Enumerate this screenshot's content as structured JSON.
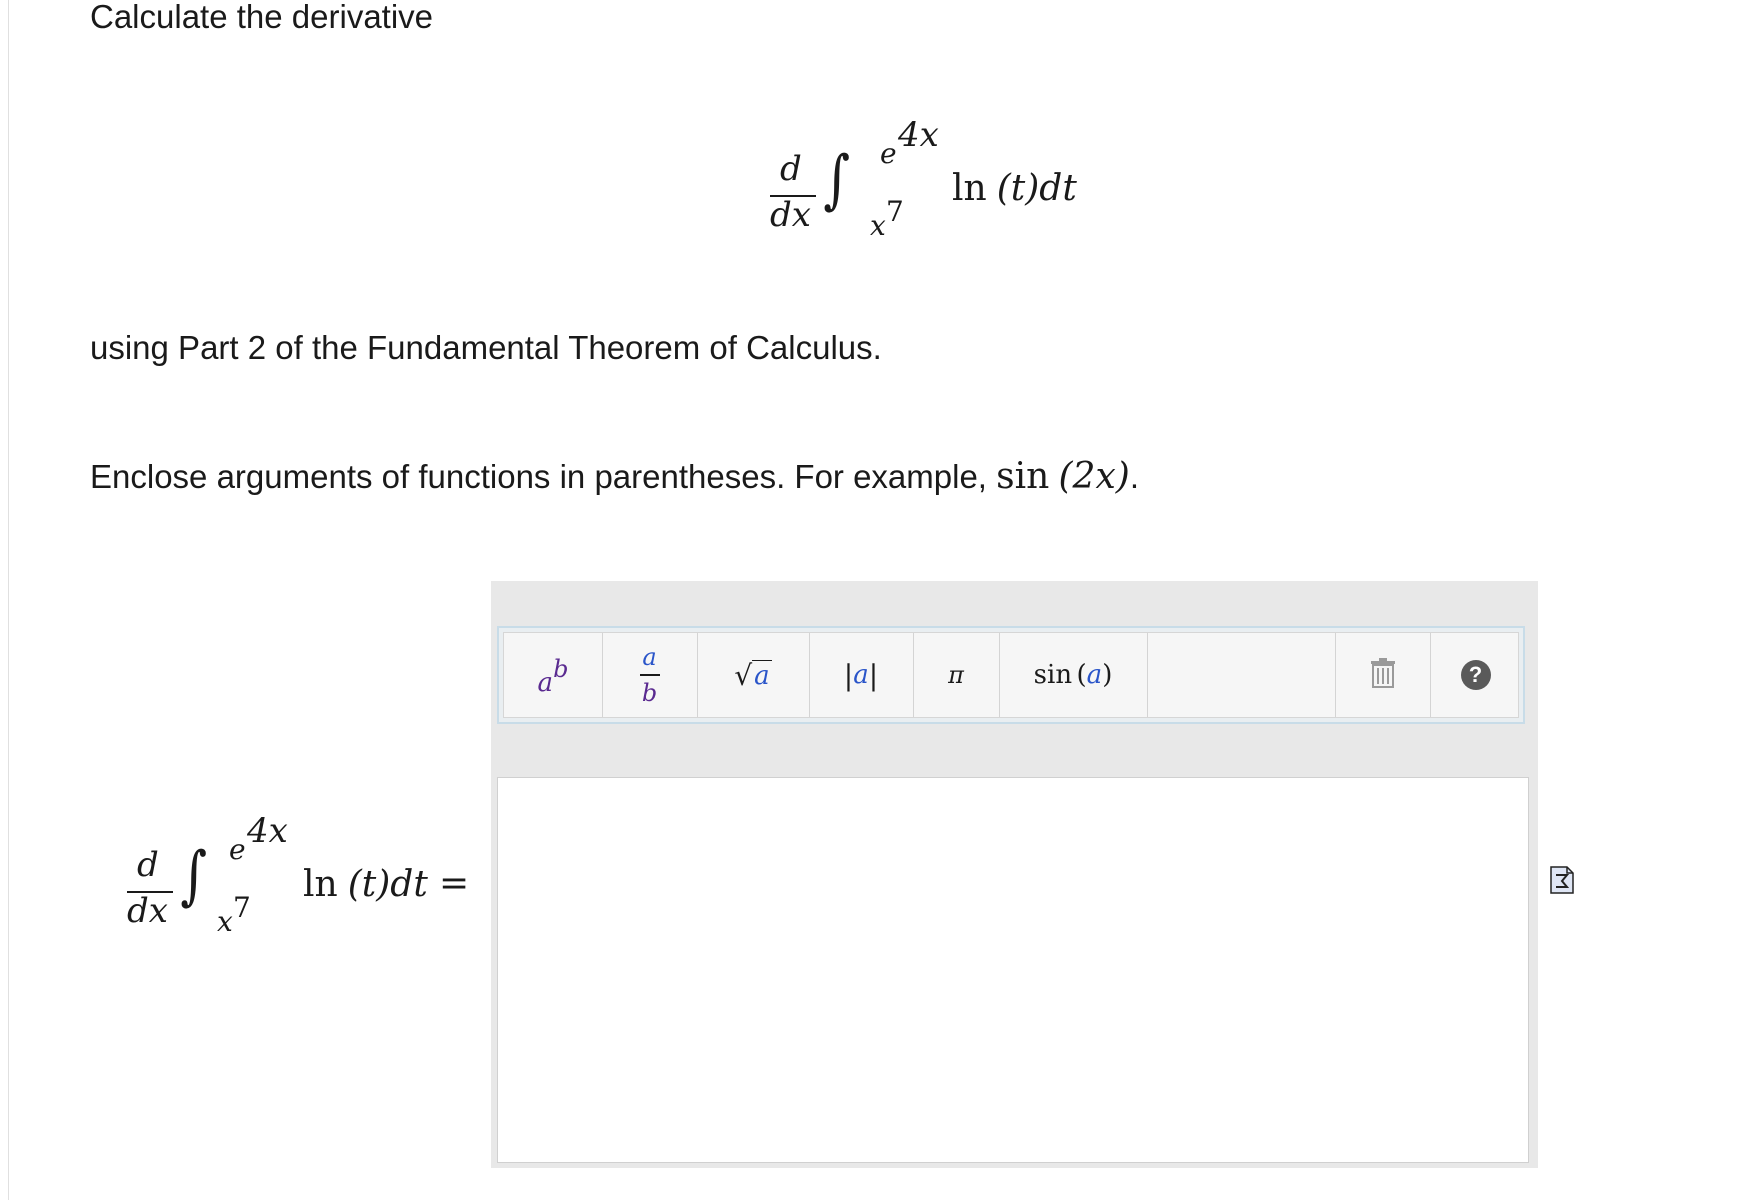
{
  "problem": {
    "intro": "Calculate the derivative",
    "instruction": "using Part 2 of the Fundamental Theorem of Calculus.",
    "note_prefix": "Enclose arguments of functions in parentheses. For example, ",
    "note_example_fn": "sin",
    "note_example_arg": "(2x)",
    "note_suffix": "."
  },
  "expression": {
    "d_num": "d",
    "d_den": "dx",
    "integral_sign": "∫",
    "upper_base": "e",
    "upper_exp": "4x",
    "lower_base": "x",
    "lower_exp": "7",
    "ln": "ln",
    "integrand_arg": "(t)",
    "dt": "dt",
    "equals": "="
  },
  "toolbar": {
    "power": {
      "base": "a",
      "exp": "b"
    },
    "fraction": {
      "num": "a",
      "den": "b"
    },
    "sqrt": {
      "radical": "√",
      "arg": "a"
    },
    "abs": {
      "bar": "|",
      "arg": "a"
    },
    "pi": "π",
    "sin": {
      "fn": "sin",
      "open": "(",
      "arg": "a",
      "close": ")"
    },
    "help_glyph": "?"
  },
  "answer": {
    "value": ""
  },
  "colors": {
    "accent_blue": "#2a55c9",
    "accent_purple": "#5a2a90",
    "editor_bg": "#e8e8e8"
  },
  "icons": [
    "trash-icon",
    "help-icon",
    "equation-editor-icon"
  ]
}
